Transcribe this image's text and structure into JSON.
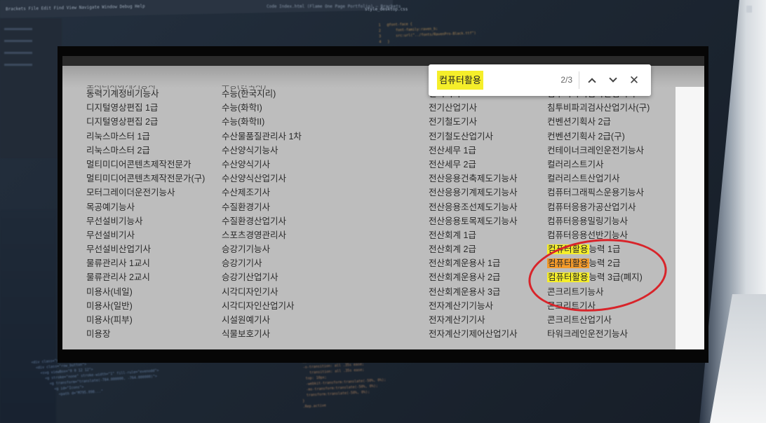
{
  "background": {
    "menubar": "Brackets   File   Edit   Find   View   Navigate   Window   Debug   Help",
    "window_title": "Code Index.html (Flame One Page Portfolio) — Brackets",
    "tab": "style_desktop.css",
    "code_top": "1   @font-face {\n2       font-family:raven_b;\n3       src:url(\"../fonts/RavenPro-Black.ttf\")\n4   }",
    "code_left": "  <div class=\"row_lightbox\">\n    <div class=\"row_button\">\n      <svg viewBox=\"0 0 12 12\">\n        <g stroke=\"none\" stroke-width=\"1\" fill-rule=\"evenodd\">\n          <g transform=\"translate(-784.000000, -764.000000)\">\n            <g id=\"Icons\">\n              <path d=\"M795.098...\"",
    "code_right": "-ms-transition: all .35s ease;\n -o-transition: all .35s ease;\n    transition: all .35s ease;\n  top: 10px;\n  -webkit-transform:translate(-50%, 0%);\n  -ms-transform:translate(-50%, 0%);\n  transform:translate(-50%, 0%);\n}\n.Rep.active"
  },
  "find_bar": {
    "query": "컴퓨터활용",
    "count": "2/3",
    "prev_label": "previous match",
    "next_label": "next match",
    "close_label": "close"
  },
  "highlight_term": "컴퓨터활용",
  "columns": {
    "col1_cutoff": "로서러처하게기능사",
    "col1": [
      "동력기계정비기능사",
      "디지털영상편집 1급",
      "디지털영상편집 2급",
      "리눅스마스터 1급",
      "리눅스마스터 2급",
      "멀티미디어콘텐츠제작전문가",
      "멀티미디어콘텐츠제작전문가(구)",
      "모터그레이더운전기능사",
      "목공예기능사",
      "무선설비기능사",
      "무선설비기사",
      "무선설비산업기사",
      "물류관리사 1교시",
      "물류관리사 2교시",
      "미용사(네일)",
      "미용사(일반)",
      "미용사(피부)",
      "미용장"
    ],
    "col2_cutoff": "수능(한국사)",
    "col2": [
      "수능(한국지리)",
      "수능(화학I)",
      "수능(화학II)",
      "수산물품질관리사 1차",
      "수산양식기능사",
      "수산양식기사",
      "수산양식산업기사",
      "수산제조기사",
      "수질환경기사",
      "수질환경산업기사",
      "스포츠경영관리사",
      "승강기기능사",
      "승강기기사",
      "승강기산업기사",
      "시각디자인기사",
      "시각디자인산업기사",
      "시설원예기사",
      "식물보호기사"
    ],
    "col3": [
      "전기기사",
      "전기산업기사",
      "전기철도기사",
      "전기철도산업기사",
      "전산세무 1급",
      "전산세무 2급",
      "전산응용건축제도기능사",
      "전산응용기계제도기능사",
      "전산응용조선제도기능사",
      "전산응용토목제도기능사",
      "전산회계 1급",
      "전산회계 2급",
      "전산회계운용사 1급",
      "전산회계운용사 2급",
      "전산회계운용사 3급",
      "전자계산기기능사",
      "전자계산기기사",
      "전자계산기제어산업기사"
    ],
    "col4": [
      "침투비파괴검사산업기사",
      "침투비파괴검사산업기사(구)",
      "컨벤션기획사 2급",
      "컨벤션기획사 2급(구)",
      "컨테이너크레인운전기능사",
      "컬러리스트기사",
      "컬러리스트산업기사",
      "컴퓨터그래픽스운용기능사",
      "컴퓨터응용가공산업기사",
      "컴퓨터응용밀링기능사",
      "컴퓨터응용선반기능사",
      "컴퓨터활용능력 1급",
      "컴퓨터활용능력 2급",
      "컴퓨터활용능력 3급(폐지)",
      "콘크리트기능사",
      "콘크리트기사",
      "콘크리트산업기사",
      "타워크레인운전기능사"
    ]
  },
  "highlighted_rows": [
    11,
    12,
    13
  ],
  "current_match_row": 12,
  "colors": {
    "highlight": "#f5ee2a",
    "current_highlight": "#f39a2a",
    "circle": "#d8242a",
    "page_bg": "#bdbdbd"
  }
}
